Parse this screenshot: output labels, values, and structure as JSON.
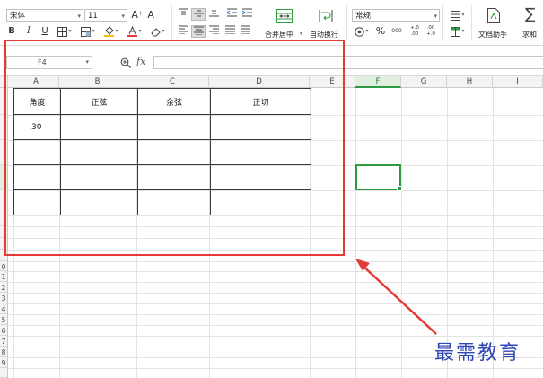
{
  "ribbon": {
    "font_name": "宋体",
    "font_size": "11",
    "grow_font": "A⁺",
    "shrink_font": "A⁻",
    "bold": "B",
    "italic": "I",
    "underline": "U",
    "merge_center": "合并居中",
    "wrap_text": "自动换行",
    "number_format": "常规",
    "percent": "%",
    "thousands": "000",
    "inc_decimal": "+.0 .00",
    "dec_decimal": ".00 +.0",
    "doc_helper": "文档助手",
    "sum": "求和",
    "sum_symbol": "∑",
    "dropdown_glyph": "▾"
  },
  "formula_bar": {
    "cell_ref": "F4",
    "fx": "fx",
    "content": ""
  },
  "columns": [
    "A",
    "B",
    "C",
    "D",
    "E",
    "F",
    "G",
    "H",
    "I"
  ],
  "selected_column": "F",
  "row_numbers": [
    "0",
    "1",
    "2",
    "3",
    "4",
    "5",
    "6",
    "7",
    "8",
    "9"
  ],
  "table": {
    "headers": [
      "角度",
      "正弦",
      "余弦",
      "正切"
    ],
    "rows": [
      [
        "30",
        "",
        "",
        ""
      ],
      [
        "",
        "",
        "",
        ""
      ],
      [
        "",
        "",
        "",
        ""
      ],
      [
        "",
        "",
        "",
        ""
      ]
    ]
  },
  "watermark": "最需教育",
  "colors": {
    "accent_green": "#2e9a41",
    "highlight_red": "#e53935",
    "watermark_blue": "#2f46b5"
  }
}
